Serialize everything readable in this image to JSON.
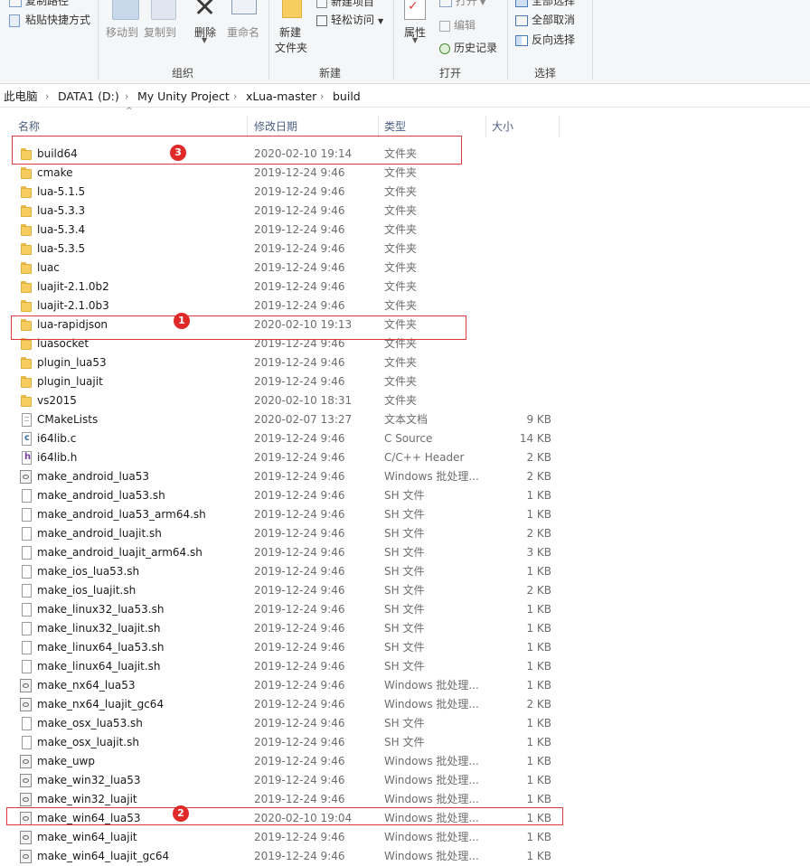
{
  "ribbon": {
    "clipboard": {
      "copy_path": "复制路径",
      "paste_shortcut": "粘贴快捷方式"
    },
    "organize": {
      "move_to": "移动到",
      "copy_to": "复制到",
      "delete": "删除",
      "rename": "重命名",
      "label": "组织"
    },
    "new": {
      "new_folder_line1": "新建",
      "new_folder_line2": "文件夹",
      "new_item": "新建项目",
      "easy_access": "轻松访问",
      "label": "新建"
    },
    "open": {
      "properties": "属性",
      "open": "打开",
      "edit": "编辑",
      "history": "历史记录",
      "label": "打开"
    },
    "select": {
      "select_all": "全部选择",
      "select_none": "全部取消",
      "invert": "反向选择",
      "label": "选择"
    }
  },
  "breadcrumb": [
    "此电脑",
    "DATA1 (D:)",
    "My Unity Project",
    "xLua-master",
    "build"
  ],
  "columns": {
    "name": "名称",
    "date": "修改日期",
    "type": "类型",
    "size": "大小"
  },
  "files": [
    {
      "name": "build64",
      "date": "2020-02-10 19:14",
      "type": "文件夹",
      "size": "",
      "icon": "folder-icon"
    },
    {
      "name": "cmake",
      "date": "2019-12-24 9:46",
      "type": "文件夹",
      "size": "",
      "icon": "folder-icon"
    },
    {
      "name": "lua-5.1.5",
      "date": "2019-12-24 9:46",
      "type": "文件夹",
      "size": "",
      "icon": "folder-icon"
    },
    {
      "name": "lua-5.3.3",
      "date": "2019-12-24 9:46",
      "type": "文件夹",
      "size": "",
      "icon": "folder-icon"
    },
    {
      "name": "lua-5.3.4",
      "date": "2019-12-24 9:46",
      "type": "文件夹",
      "size": "",
      "icon": "folder-icon"
    },
    {
      "name": "lua-5.3.5",
      "date": "2019-12-24 9:46",
      "type": "文件夹",
      "size": "",
      "icon": "folder-icon"
    },
    {
      "name": "luac",
      "date": "2019-12-24 9:46",
      "type": "文件夹",
      "size": "",
      "icon": "folder-icon"
    },
    {
      "name": "luajit-2.1.0b2",
      "date": "2019-12-24 9:46",
      "type": "文件夹",
      "size": "",
      "icon": "folder-icon"
    },
    {
      "name": "luajit-2.1.0b3",
      "date": "2019-12-24 9:46",
      "type": "文件夹",
      "size": "",
      "icon": "folder-icon"
    },
    {
      "name": "lua-rapidjson",
      "date": "2020-02-10 19:13",
      "type": "文件夹",
      "size": "",
      "icon": "folder-icon"
    },
    {
      "name": "luasocket",
      "date": "2019-12-24 9:46",
      "type": "文件夹",
      "size": "",
      "icon": "folder-icon"
    },
    {
      "name": "plugin_lua53",
      "date": "2019-12-24 9:46",
      "type": "文件夹",
      "size": "",
      "icon": "folder-icon"
    },
    {
      "name": "plugin_luajit",
      "date": "2019-12-24 9:46",
      "type": "文件夹",
      "size": "",
      "icon": "folder-icon"
    },
    {
      "name": "vs2015",
      "date": "2020-02-10 18:31",
      "type": "文件夹",
      "size": "",
      "icon": "folder-icon"
    },
    {
      "name": "CMakeLists",
      "date": "2020-02-07 13:27",
      "type": "文本文档",
      "size": "9 KB",
      "icon": "text-file-icon"
    },
    {
      "name": "i64lib.c",
      "date": "2019-12-24 9:46",
      "type": "C Source",
      "size": "14 KB",
      "icon": "c-source-file-icon"
    },
    {
      "name": "i64lib.h",
      "date": "2019-12-24 9:46",
      "type": "C/C++ Header",
      "size": "2 KB",
      "icon": "header-file-icon"
    },
    {
      "name": "make_android_lua53",
      "date": "2019-12-24 9:46",
      "type": "Windows 批处理...",
      "size": "2 KB",
      "icon": "batch-file-icon"
    },
    {
      "name": "make_android_lua53.sh",
      "date": "2019-12-24 9:46",
      "type": "SH 文件",
      "size": "1 KB",
      "icon": "file-icon"
    },
    {
      "name": "make_android_lua53_arm64.sh",
      "date": "2019-12-24 9:46",
      "type": "SH 文件",
      "size": "1 KB",
      "icon": "file-icon"
    },
    {
      "name": "make_android_luajit.sh",
      "date": "2019-12-24 9:46",
      "type": "SH 文件",
      "size": "2 KB",
      "icon": "file-icon"
    },
    {
      "name": "make_android_luajit_arm64.sh",
      "date": "2019-12-24 9:46",
      "type": "SH 文件",
      "size": "3 KB",
      "icon": "file-icon"
    },
    {
      "name": "make_ios_lua53.sh",
      "date": "2019-12-24 9:46",
      "type": "SH 文件",
      "size": "1 KB",
      "icon": "file-icon"
    },
    {
      "name": "make_ios_luajit.sh",
      "date": "2019-12-24 9:46",
      "type": "SH 文件",
      "size": "2 KB",
      "icon": "file-icon"
    },
    {
      "name": "make_linux32_lua53.sh",
      "date": "2019-12-24 9:46",
      "type": "SH 文件",
      "size": "1 KB",
      "icon": "file-icon"
    },
    {
      "name": "make_linux32_luajit.sh",
      "date": "2019-12-24 9:46",
      "type": "SH 文件",
      "size": "1 KB",
      "icon": "file-icon"
    },
    {
      "name": "make_linux64_lua53.sh",
      "date": "2019-12-24 9:46",
      "type": "SH 文件",
      "size": "1 KB",
      "icon": "file-icon"
    },
    {
      "name": "make_linux64_luajit.sh",
      "date": "2019-12-24 9:46",
      "type": "SH 文件",
      "size": "1 KB",
      "icon": "file-icon"
    },
    {
      "name": "make_nx64_lua53",
      "date": "2019-12-24 9:46",
      "type": "Windows 批处理...",
      "size": "1 KB",
      "icon": "batch-file-icon"
    },
    {
      "name": "make_nx64_luajit_gc64",
      "date": "2019-12-24 9:46",
      "type": "Windows 批处理...",
      "size": "2 KB",
      "icon": "batch-file-icon"
    },
    {
      "name": "make_osx_lua53.sh",
      "date": "2019-12-24 9:46",
      "type": "SH 文件",
      "size": "1 KB",
      "icon": "file-icon"
    },
    {
      "name": "make_osx_luajit.sh",
      "date": "2019-12-24 9:46",
      "type": "SH 文件",
      "size": "1 KB",
      "icon": "file-icon"
    },
    {
      "name": "make_uwp",
      "date": "2019-12-24 9:46",
      "type": "Windows 批处理...",
      "size": "1 KB",
      "icon": "batch-file-icon"
    },
    {
      "name": "make_win32_lua53",
      "date": "2019-12-24 9:46",
      "type": "Windows 批处理...",
      "size": "1 KB",
      "icon": "batch-file-icon"
    },
    {
      "name": "make_win32_luajit",
      "date": "2019-12-24 9:46",
      "type": "Windows 批处理...",
      "size": "1 KB",
      "icon": "batch-file-icon"
    },
    {
      "name": "make_win64_lua53",
      "date": "2020-02-10 19:04",
      "type": "Windows 批处理...",
      "size": "1 KB",
      "icon": "batch-file-icon"
    },
    {
      "name": "make_win64_luajit",
      "date": "2019-12-24 9:46",
      "type": "Windows 批处理...",
      "size": "1 KB",
      "icon": "batch-file-icon"
    },
    {
      "name": "make_win64_luajit_gc64",
      "date": "2019-12-24 9:46",
      "type": "Windows 批处理...",
      "size": "1 KB",
      "icon": "batch-file-icon"
    }
  ],
  "annotations": [
    {
      "number": "1",
      "target": "lua-rapidjson"
    },
    {
      "number": "2",
      "target": "make_win64_lua53"
    },
    {
      "number": "3",
      "target": "build64"
    }
  ],
  "colors": {
    "annotation": "#e0393e",
    "badge": "#e02a2a",
    "folder": "#f6cd5e",
    "header_text": "#4d6082"
  }
}
